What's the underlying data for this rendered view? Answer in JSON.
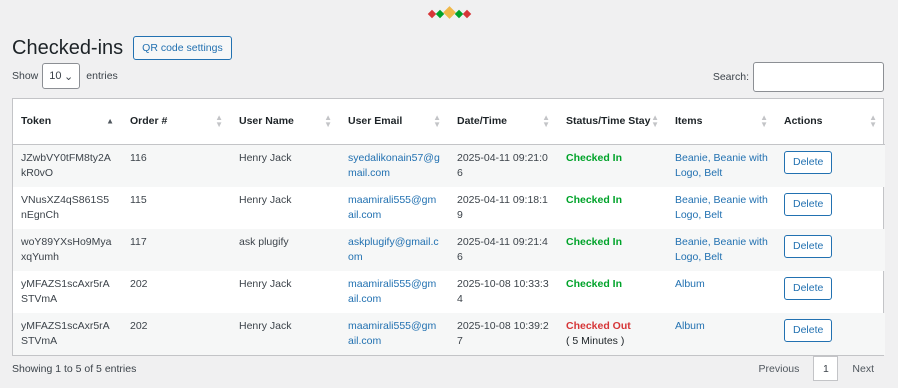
{
  "page": {
    "title": "Checked-ins",
    "qr_button": "QR code settings"
  },
  "length": {
    "show": "Show",
    "value": "10",
    "entries": "entries"
  },
  "search": {
    "label": "Search:",
    "value": ""
  },
  "columns": [
    "Token",
    "Order #",
    "User Name",
    "User Email",
    "Date/Time",
    "Status/Time Stay",
    "Items",
    "Actions"
  ],
  "rows": [
    {
      "token": "JZwbVY0tFM8ty2AkR0vO",
      "order": "116",
      "user": "Henry Jack",
      "email": "syedalikonain57@gmail.com",
      "datetime": "2025-04-11 09:21:06",
      "status": "Checked In",
      "stay": "",
      "items": "Beanie, Beanie with Logo, Belt",
      "action": "Delete"
    },
    {
      "token": "VNusXZ4qS861S5nEgnCh",
      "order": "115",
      "user": "Henry Jack",
      "email": "maamirali555@gmail.com",
      "datetime": "2025-04-11 09:18:19",
      "status": "Checked In",
      "stay": "",
      "items": "Beanie, Beanie with Logo, Belt",
      "action": "Delete"
    },
    {
      "token": "woY89YXsHo9MyaxqYumh",
      "order": "117",
      "user": "ask plugify",
      "email": "askplugify@gmail.com",
      "datetime": "2025-04-11 09:21:46",
      "status": "Checked In",
      "stay": "",
      "items": "Beanie, Beanie with Logo, Belt",
      "action": "Delete"
    },
    {
      "token": "yMFAZS1scAxr5rASTVmA",
      "order": "202",
      "user": "Henry Jack",
      "email": "maamirali555@gmail.com",
      "datetime": "2025-10-08 10:33:34",
      "status": "Checked In",
      "stay": "",
      "items": "Album",
      "action": "Delete"
    },
    {
      "token": "yMFAZS1scAxr5rASTVmA",
      "order": "202",
      "user": "Henry Jack",
      "email": "maamirali555@gmail.com",
      "datetime": "2025-10-08 10:39:27",
      "status": "Checked Out",
      "stay": "( 5 Minutes )",
      "items": "Album",
      "action": "Delete"
    }
  ],
  "footer": {
    "info": "Showing 1 to 5 of 5 entries",
    "previous": "Previous",
    "page": "1",
    "next": "Next"
  },
  "colors": {
    "accent": "#2271b1",
    "checked_in": "#00a32a",
    "checked_out": "#d63638"
  }
}
